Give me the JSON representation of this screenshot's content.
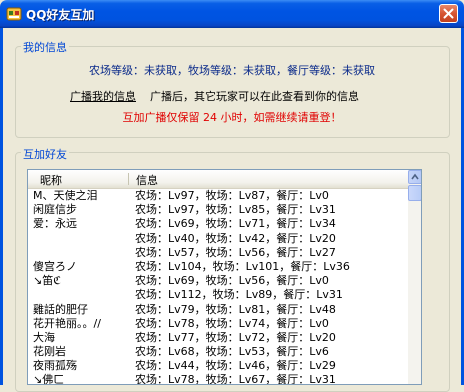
{
  "window": {
    "title": "QQ好友互加",
    "colors": {
      "titlebar": "#0054E3",
      "close": "#D65533",
      "accent": "#0046D5",
      "notice": "#E00000"
    }
  },
  "my_info": {
    "legend": "我的信息",
    "levels": "农场等级：未获取，牧场等级：未获取，餐厅等级：未获取",
    "broadcast_link": "广播我的信息",
    "broadcast_desc": "广播后，其它玩家可以在此查看到你的信息",
    "notice": "互加广播仅保留 24 小时，如需继续请重登！"
  },
  "friends": {
    "legend": "互加好友",
    "columns": {
      "nickname": "昵称",
      "info": "信息"
    },
    "rows": [
      {
        "nick": "M、天使之泪",
        "info": "农场：Lv97，牧场：Lv87，餐厅：Lv0"
      },
      {
        "nick": "闲庭信步",
        "info": "农场：Lv97，牧场：Lv85，餐厅：Lv31"
      },
      {
        "nick": "爱：永远",
        "info": "农场：Lv69，牧场：Lv71，餐厅：Lv34"
      },
      {
        "nick": "",
        "info": "农场：Lv40，牧场：Lv42，餐厅：Lv20"
      },
      {
        "nick": "",
        "info": "农场：Lv57，牧场：Lv56，餐厅：Lv27"
      },
      {
        "nick": "傻宫ろノ",
        "info": "农场：Lv104，牧场：Lv101，餐厅：Lv36"
      },
      {
        "nick": "↘笛ℭ",
        "info": "农场：Lv69，牧场：Lv56，餐厅：Lv0"
      },
      {
        "nick": "",
        "info": "农场：Lv112，牧场：Lv89，餐厅：Lv31"
      },
      {
        "nick": "雞話的肥仔",
        "info": "农场：Lv79，牧场：Lv81，餐厅：Lv48"
      },
      {
        "nick": "花开艳丽。。//",
        "info": "农场：Lv78，牧场：Lv74，餐厅：Lv0"
      },
      {
        "nick": "大海",
        "info": "农场：Lv77，牧场：Lv72，餐厅：Lv20"
      },
      {
        "nick": "花刚岩",
        "info": "农场：Lv68，牧场：Lv53，餐厅：Lv6"
      },
      {
        "nick": "夜雨孤殇",
        "info": "农场：Lv44，牧场：Lv46，餐厅：Lv29"
      },
      {
        "nick": "↘佛ㄈ",
        "info": "农场：Lv78，牧场：Lv67，餐厅：Lv31"
      }
    ]
  }
}
